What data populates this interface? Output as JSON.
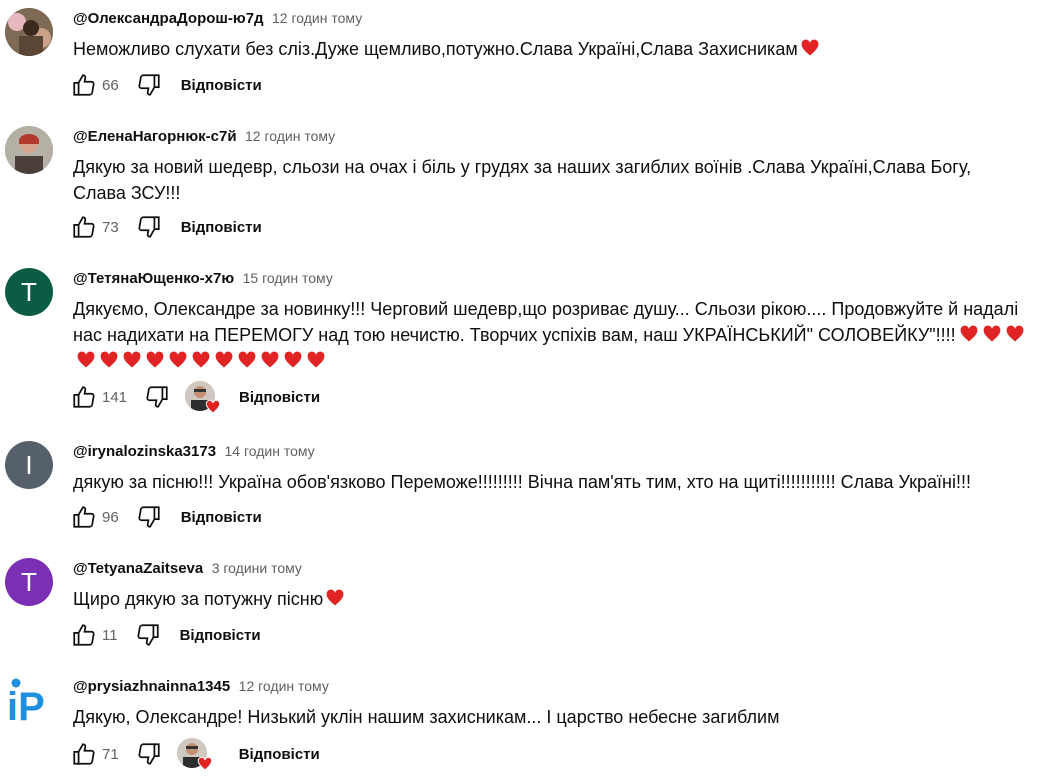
{
  "icons": {
    "like": "thumb-up-icon",
    "dislike": "thumb-down-icon",
    "heart": "heart-emoji"
  },
  "colors": {
    "heart": "#e02424",
    "avatar_t1": "#0b5c45",
    "avatar_i": "#56606b",
    "avatar_t2": "#7b2fb5",
    "ip_logo": "#1f8fe0"
  },
  "comments": [
    {
      "author": "@ОлександраДорош-ю7д",
      "time": "12 годин тому",
      "text": "Неможливо слухати без сліз.Дуже щемливо,потужно.Слава Україні,Слава Захисникам",
      "likes": "66",
      "reply": "Відповісти",
      "avatar_type": "photo"
    },
    {
      "author": "@ЕленаНагорнюк-с7й",
      "time": "12 годин тому",
      "text": "Дякую за новий шедевр, сльози на очах і біль у грудях за наших загиблих воїнів .Слава Україні,Слава Богу, Слава ЗСУ!!!",
      "likes": "73",
      "reply": "Відповісти",
      "avatar_type": "photo"
    },
    {
      "author": "@ТетянаЮщенко-х7ю",
      "time": "15 годин тому",
      "text": "Дякуємо, Олександре за новинку!!! Черговий шедевр,що розриває душу... Сльози рікою.... Продовжуйте й надалі нас надихати на ПЕРЕМОГУ над тою нечистю. Творчих успіхів вам, наш УКРАЇНСЬКИЙ\" СОЛОВЕЙКУ\"!!!!",
      "likes": "141",
      "reply": "Відповісти",
      "avatar_letter": "T",
      "creator_heart": true
    },
    {
      "author": "@irynalozinska3173",
      "time": "14 годин тому",
      "text": "дякую за пісню!!! Україна обов'язково Переможе!!!!!!!!! Вічна пам'ять тим, хто на щиті!!!!!!!!!!! Слава Україні!!!",
      "likes": "96",
      "reply": "Відповісти",
      "avatar_letter": "I"
    },
    {
      "author": "@TetyanaZaitseva",
      "time": "3 години тому",
      "text": "Щиро дякую за потужну пісню",
      "likes": "11",
      "reply": "Відповісти",
      "avatar_letter": "T"
    },
    {
      "author": "@prysiazhnainna1345",
      "time": "12 годин тому",
      "text": "Дякую, Олександре! Низький уклін нашим захисникам... І царство небесне загиблим",
      "likes": "71",
      "reply": "Відповісти",
      "avatar_logo": "iP",
      "creator_heart": true
    }
  ]
}
